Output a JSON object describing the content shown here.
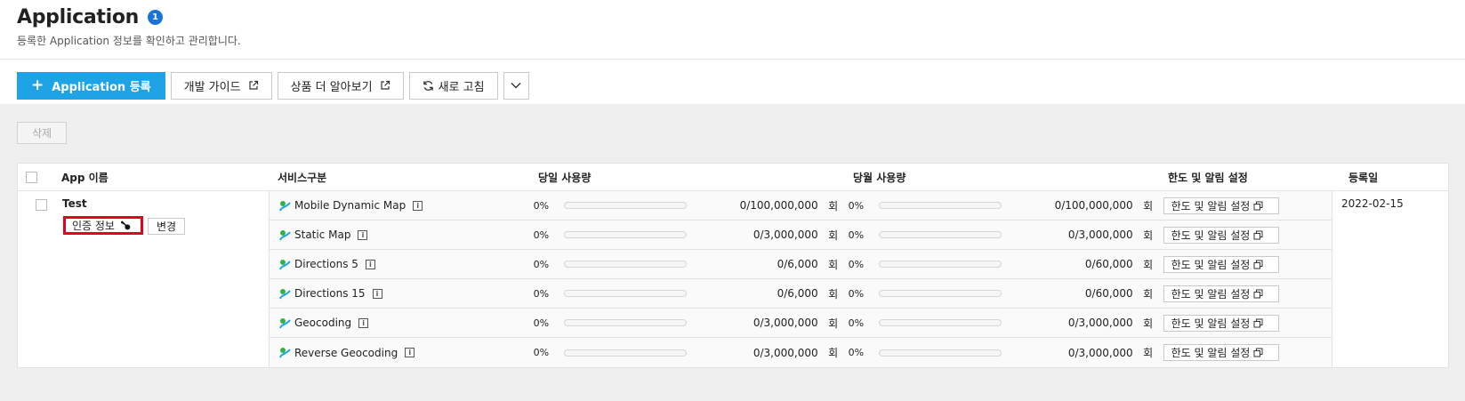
{
  "header": {
    "title": "Application",
    "count": "1",
    "subtitle": "등록한 Application 정보를 확인하고 관리합니다."
  },
  "toolbar": {
    "register_label": "Application 등록",
    "guide_label": "개발 가이드",
    "product_label": "상품 더 알아보기",
    "refresh_label": "새로 고침"
  },
  "actions": {
    "delete_label": "삭제"
  },
  "table": {
    "headers": {
      "app": "App 이름",
      "service": "서비스구분",
      "daily": "당일 사용량",
      "monthly": "당월 사용량",
      "limit": "한도 및 알림 설정",
      "registered": "등록일"
    },
    "app": {
      "name": "Test",
      "auth_label": "인증 정보",
      "change_label": "변경",
      "registered": "2022-02-15"
    },
    "rows": [
      {
        "service": "Mobile Dynamic Map",
        "day_pct": "0%",
        "day_qty": "0/100,000,000",
        "day_unit": "회",
        "month_pct": "0%",
        "month_qty": "0/100,000,000",
        "month_unit": "회",
        "limit_label": "한도 및 알림 설정"
      },
      {
        "service": "Static Map",
        "day_pct": "0%",
        "day_qty": "0/3,000,000",
        "day_unit": "회",
        "month_pct": "0%",
        "month_qty": "0/3,000,000",
        "month_unit": "회",
        "limit_label": "한도 및 알림 설정"
      },
      {
        "service": "Directions 5",
        "day_pct": "0%",
        "day_qty": "0/6,000",
        "day_unit": "회",
        "month_pct": "0%",
        "month_qty": "0/60,000",
        "month_unit": "회",
        "limit_label": "한도 및 알림 설정"
      },
      {
        "service": "Directions 15",
        "day_pct": "0%",
        "day_qty": "0/6,000",
        "day_unit": "회",
        "month_pct": "0%",
        "month_qty": "0/60,000",
        "month_unit": "회",
        "limit_label": "한도 및 알림 설정"
      },
      {
        "service": "Geocoding",
        "day_pct": "0%",
        "day_qty": "0/3,000,000",
        "day_unit": "회",
        "month_pct": "0%",
        "month_qty": "0/3,000,000",
        "month_unit": "회",
        "limit_label": "한도 및 알림 설정"
      },
      {
        "service": "Reverse Geocoding",
        "day_pct": "0%",
        "day_qty": "0/3,000,000",
        "day_unit": "회",
        "month_pct": "0%",
        "month_qty": "0/3,000,000",
        "month_unit": "회",
        "limit_label": "한도 및 알림 설정"
      }
    ]
  },
  "icons": {
    "primary_color": "#1ea4e6",
    "badge_color": "#1a73d9",
    "highlight_color": "#e3001b"
  }
}
